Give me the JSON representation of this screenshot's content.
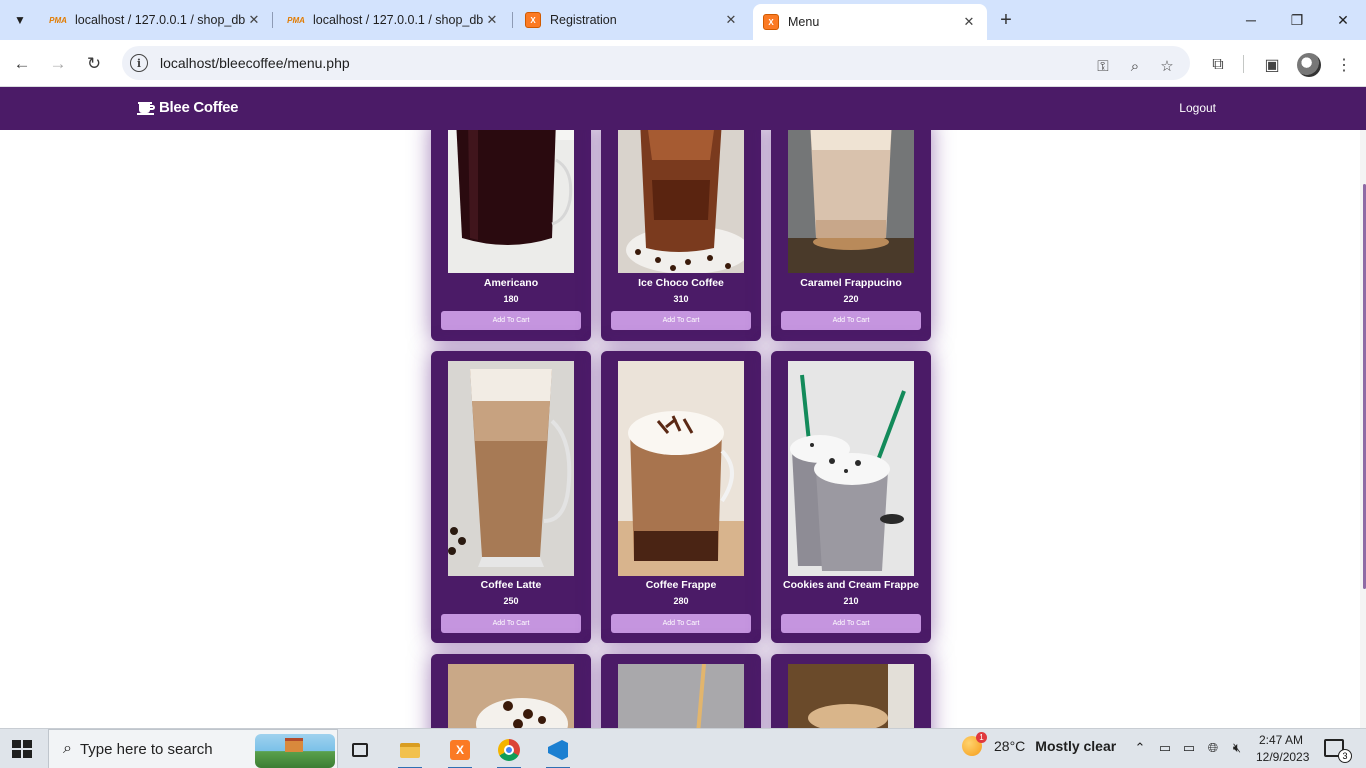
{
  "browser": {
    "tabs": [
      {
        "title": "localhost / 127.0.0.1 / shop_db",
        "icon": "phpmyadmin-icon",
        "active": false
      },
      {
        "title": "localhost / 127.0.0.1 / shop_db",
        "icon": "phpmyadmin-icon",
        "active": false
      },
      {
        "title": "Registration",
        "icon": "xampp-icon",
        "active": false
      },
      {
        "title": "Menu",
        "icon": "xampp-icon",
        "active": true
      }
    ],
    "fav_pma_text": "PMA",
    "fav_xampp_text": "X",
    "url": "localhost/bleecoffee/menu.php"
  },
  "site": {
    "brand": "Blee Coffee",
    "logout_label": "Logout",
    "colors": {
      "primary": "#4b1b67",
      "button": "#c595df"
    }
  },
  "products": [
    {
      "name": "Americano",
      "price": "180",
      "button": "Add To Cart"
    },
    {
      "name": "Ice Choco Coffee",
      "price": "310",
      "button": "Add To Cart"
    },
    {
      "name": "Caramel Frappucino",
      "price": "220",
      "button": "Add To Cart"
    },
    {
      "name": "Coffee Latte",
      "price": "250",
      "button": "Add To Cart"
    },
    {
      "name": "Coffee Frappe",
      "price": "280",
      "button": "Add To Cart"
    },
    {
      "name": "Cookies and Cream Frappe",
      "price": "210",
      "button": "Add To Cart"
    }
  ],
  "taskbar": {
    "search_placeholder": "Type here to search",
    "weather_temp": "28°C",
    "weather_condition": "Mostly clear",
    "weather_badge": "1",
    "time": "2:47 AM",
    "date": "12/9/2023",
    "notification_count": "3"
  }
}
